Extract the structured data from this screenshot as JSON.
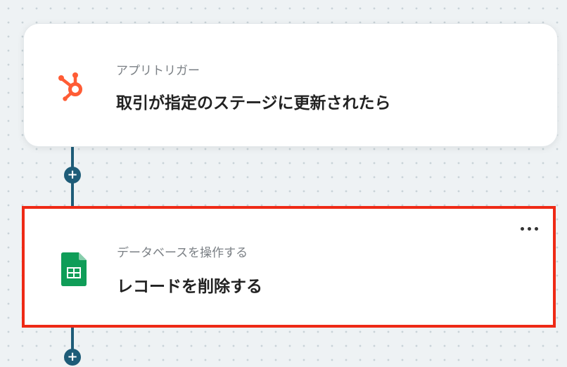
{
  "flow": {
    "trigger": {
      "type_label": "アプリトリガー",
      "title": "取引が指定のステージに更新されたら",
      "icon": "hubspot-icon",
      "icon_color": "#ff5c35"
    },
    "action": {
      "type_label": "データベースを操作する",
      "title": "レコードを削除する",
      "icon": "google-sheets-icon",
      "icon_color": "#0f9d58",
      "highlighted": true,
      "highlight_color": "#ee2a16"
    },
    "add_step_symbol": "+",
    "connector_color": "#1e5c78"
  }
}
